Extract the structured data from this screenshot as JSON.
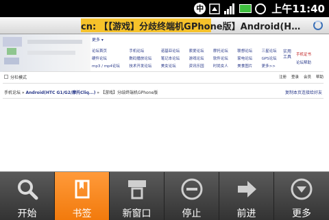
{
  "status_bar": {
    "carrier_icon_text": "中",
    "time": "上午11:40",
    "icons": [
      "china-mobile-icon",
      "wifi-icon",
      "signal-icon",
      "battery-icon",
      "alarm-icon"
    ]
  },
  "browser": {
    "title": "cn: 【【游戏】分歧终端机GPhone版】Android(H…",
    "loading_icon": "spinner-icon"
  },
  "page": {
    "more_link": "更多 ▾",
    "nav_links": [
      "论坛首页",
      "手机论坛",
      "诺基亚论坛",
      "索爱论坛",
      "摩托论坛",
      "联想论坛",
      "三星论坛",
      "硬件论坛",
      "数码播放论坛",
      "笔记本论坛",
      "游戏论坛",
      "软件论坛",
      "家电论坛",
      "GPS论坛",
      "mp3 / mp4论坛",
      "技术开发论坛",
      "美女论坛",
      "资讯乐园",
      "时尚女人",
      "美食图片",
      "更多>>"
    ],
    "side_column": "实用工具",
    "side_links": [
      "手机证书",
      "论坛帮助"
    ],
    "mode_label": "分栏模式",
    "user_links": [
      "注册",
      "登录",
      "会员",
      "帮助"
    ],
    "breadcrumb": {
      "prefix": "手机论坛 »",
      "forum": "Android(HTC G1/G2/摩托Cliq...)",
      "separator": " » ",
      "thread": "【游戏】分歧终端机GPhone版"
    },
    "copy_link": "复制本页连接给好友"
  },
  "menu": {
    "items": [
      {
        "label": "开始",
        "icon": "search-icon"
      },
      {
        "label": "书签",
        "icon": "bookmark-icon"
      },
      {
        "label": "新窗口",
        "icon": "new-window-icon"
      },
      {
        "label": "停止",
        "icon": "stop-icon"
      },
      {
        "label": "前进",
        "icon": "forward-icon"
      },
      {
        "label": "更多",
        "icon": "more-icon"
      }
    ],
    "active_index": 1
  },
  "colors": {
    "status_bar_bg": "#000000",
    "title_highlight": "#f6c22a",
    "menu_active": "#f27a0c",
    "menu_bg": "#3a3a3a",
    "link": "#2a3a8a",
    "battery": "#3fbf3f"
  }
}
